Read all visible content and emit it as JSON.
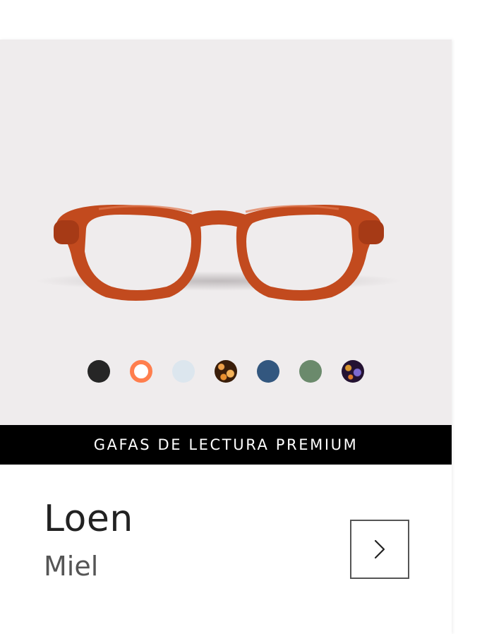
{
  "product": {
    "name": "Loen",
    "color_name": "Miel",
    "category_banner": "GAFAS DE LECTURA PREMIUM",
    "frame_color": "#c24a1e",
    "background_color": "#efeced"
  },
  "swatches": [
    {
      "name": "black",
      "color": "#262626",
      "selected": false
    },
    {
      "name": "honey",
      "color": "#ff7e4d",
      "selected": true
    },
    {
      "name": "light-blue",
      "color": "#dce6ee",
      "selected": false
    },
    {
      "name": "tortoise",
      "color": "#8a4a12",
      "selected": false
    },
    {
      "name": "navy-blue",
      "color": "#33577f",
      "selected": false
    },
    {
      "name": "green",
      "color": "#6b8a6c",
      "selected": false
    },
    {
      "name": "purple-tortoise",
      "color": "#4a2a5a",
      "selected": false
    }
  ],
  "icons": {
    "next": "chevron-right-icon"
  }
}
